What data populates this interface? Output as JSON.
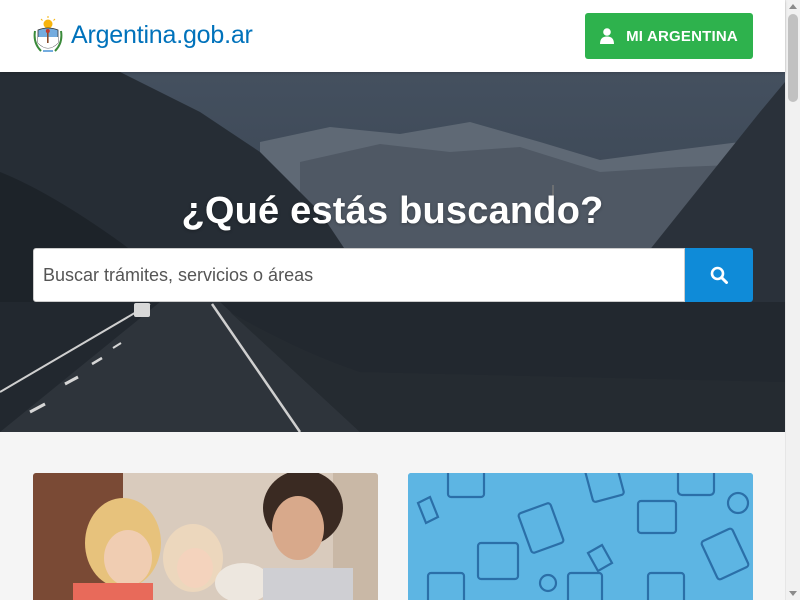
{
  "header": {
    "brand_name": "Argentina.gob.ar",
    "mi_argentina_label": "MI ARGENTINA"
  },
  "hero": {
    "title": "¿Qué estás buscando?",
    "search_placeholder": "Buscar trámites, servicios o áreas"
  },
  "colors": {
    "brand_blue": "#0072bb",
    "mi_argentina_green": "#2eb24d",
    "search_button_blue": "#0f8bd8",
    "dni_card_blue": "#5db5e3"
  },
  "icons": {
    "logo": "coat-of-arms-icon",
    "user": "user-icon",
    "search": "search-icon"
  }
}
